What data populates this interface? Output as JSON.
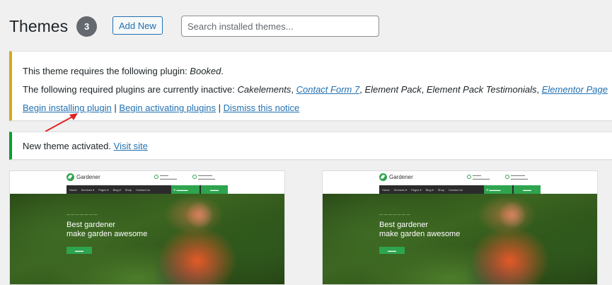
{
  "header": {
    "title": "Themes",
    "count": "3",
    "add_new_label": "Add New",
    "search_placeholder": "Search installed themes..."
  },
  "plugin_notice": {
    "line1_prefix": "This theme requires the following plugin: ",
    "line1_plugin": "Booked",
    "line1_suffix": ".",
    "line2_prefix": "The following required plugins are currently inactive: ",
    "plugins": [
      {
        "name": "Cakelements",
        "link": false
      },
      {
        "name": "Contact Form 7",
        "link": true
      },
      {
        "name": "Element Pack",
        "link": false
      },
      {
        "name": "Element Pack Testimonials",
        "link": false
      },
      {
        "name": "Elementor Page",
        "link": true
      }
    ],
    "actions": {
      "begin_installing": "Begin installing plugin",
      "begin_activating": "Begin activating plugins",
      "dismiss": "Dismiss this notice"
    },
    "separator": "|",
    "accent_color": "#dba617"
  },
  "activated_notice": {
    "message": "New theme activated.",
    "link": "Visit site",
    "accent_color": "#00a32a"
  },
  "themes": [
    {
      "site_name": "Gardener",
      "nav": [
        "Home",
        "Services ▾",
        "Pages ▾",
        "Blog ▾",
        "Shop",
        "Contact Us"
      ],
      "hero_line1": "Best gardener",
      "hero_line2": "make garden awesome"
    },
    {
      "site_name": "Gardener",
      "nav": [
        "Home",
        "Services ▾",
        "Pages ▾",
        "Blog ▾",
        "Shop",
        "Contact Us"
      ],
      "hero_line1": "Best gardener",
      "hero_line2": "make garden awesome"
    }
  ],
  "colors": {
    "link": "#2271b1",
    "badge": "#646970",
    "theme_green": "#2ea44f"
  }
}
